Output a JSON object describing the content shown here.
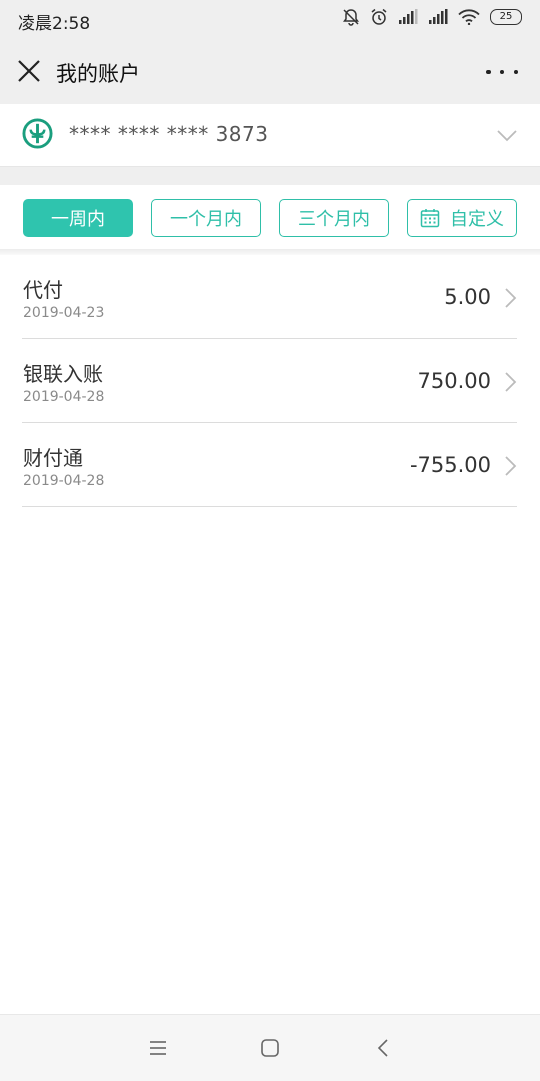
{
  "status_bar": {
    "time": "凌晨2:58",
    "battery": "25",
    "icons": [
      "mute-bell-icon",
      "alarm-icon",
      "signal-icon",
      "signal-icon",
      "wifi-icon",
      "battery-icon"
    ]
  },
  "header": {
    "title": "我的账户",
    "close_icon": "close-icon",
    "more_icon": "more-icon"
  },
  "account": {
    "number": "**** **** **** 3873",
    "bank_icon": "bank-logo-icon",
    "brand_color": "#1a9e7e"
  },
  "filters": {
    "accent_color": "#2fc4ae",
    "items": [
      {
        "label": "一周内",
        "active": true
      },
      {
        "label": "一个月内",
        "active": false
      },
      {
        "label": "三个月内",
        "active": false
      },
      {
        "label": "自定义",
        "active": false,
        "icon": "calendar-icon"
      }
    ]
  },
  "transactions": [
    {
      "name": "代付",
      "date": "2019-04-23",
      "amount": "5.00"
    },
    {
      "name": "银联入账",
      "date": "2019-04-28",
      "amount": "750.00"
    },
    {
      "name": "财付通",
      "date": "2019-04-28",
      "amount": "-755.00"
    }
  ],
  "nav_bar": {
    "icons": [
      "menu-icon",
      "home-icon",
      "back-icon"
    ]
  }
}
